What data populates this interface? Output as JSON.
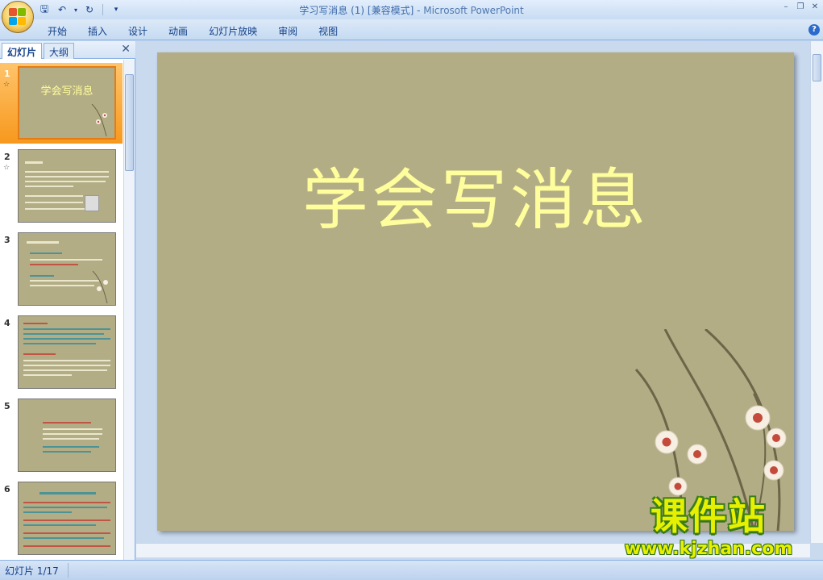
{
  "window": {
    "title": "学习写消息 (1) [兼容模式]",
    "title_sep": " - ",
    "app_name": "Microsoft PowerPoint"
  },
  "quick_access": [
    "save-icon",
    "undo-icon",
    "redo-icon",
    "customize-icon"
  ],
  "ribbon": {
    "tabs": [
      "开始",
      "插入",
      "设计",
      "动画",
      "幻灯片放映",
      "审阅",
      "视图"
    ]
  },
  "left_pane": {
    "tabs": {
      "slides": "幻灯片",
      "outline": "大纲"
    },
    "thumbnails": [
      {
        "number": "1",
        "title": "学会写消息",
        "selected": true,
        "has_transition": true
      },
      {
        "number": "2",
        "selected": false,
        "has_transition": true
      },
      {
        "number": "3",
        "selected": false,
        "has_transition": false
      },
      {
        "number": "4",
        "selected": false,
        "has_transition": false
      },
      {
        "number": "5",
        "selected": false,
        "has_transition": false
      },
      {
        "number": "6",
        "selected": false,
        "has_transition": false
      }
    ]
  },
  "slide": {
    "title": "学会写消息",
    "background": "#b3ad86",
    "title_color": "#fffe9c"
  },
  "watermark": {
    "main": "课件站",
    "url": "www.kjzhan.com"
  },
  "status": {
    "slide_counter": "幻灯片 1/17"
  },
  "colors": {
    "selection": "#f7981d",
    "ribbon": "#c5daf1"
  }
}
